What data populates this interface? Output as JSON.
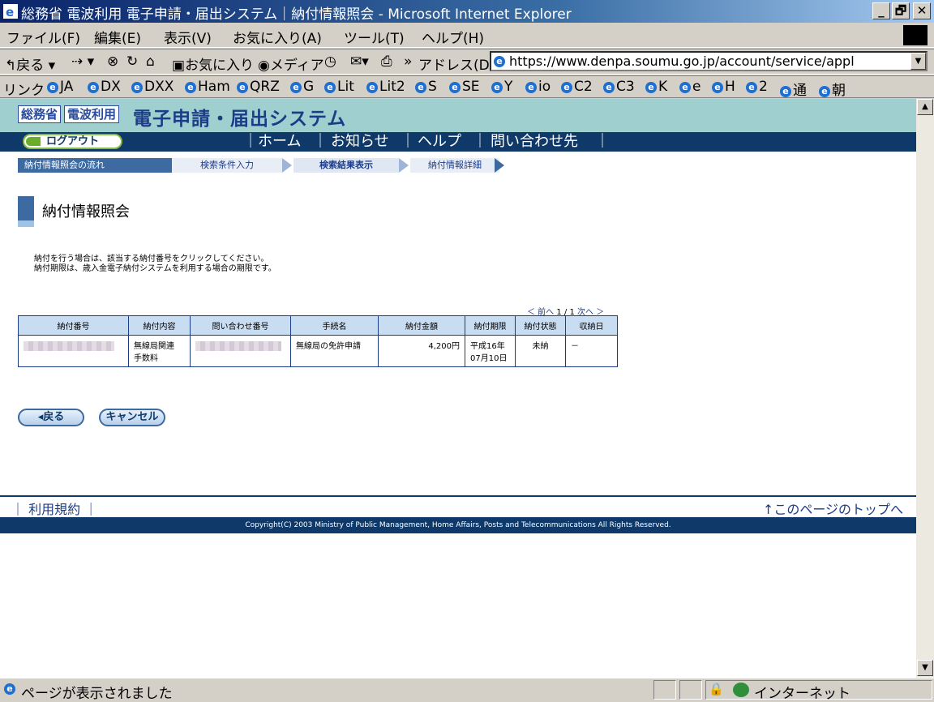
{
  "window": {
    "title": "総務省 電波利用 電子申請・届出システム｜納付情報照会 - Microsoft Internet Explorer",
    "min": "_",
    "max": "🗗",
    "close": "✕"
  },
  "menu": [
    "ファイル(F)",
    "編集(E)",
    "表示(V)",
    "お気に入り(A)",
    "ツール(T)",
    "ヘルプ(H)"
  ],
  "toolbar": {
    "back": "戻る",
    "favorites": "お気に入り",
    "media": "メディア",
    "address_label": "アドレス(D)",
    "address_value": "https://www.denpa.soumu.go.jp/account/service/appl"
  },
  "links": {
    "label": "リンク",
    "items": [
      "JA",
      "DX",
      "DXX",
      "Ham",
      "QRZ",
      "G",
      "Lit",
      "Lit2",
      "S",
      "SE",
      "Y",
      "io",
      "C2",
      "C3",
      "K",
      "e",
      "H",
      "2",
      "通",
      "朝"
    ]
  },
  "site": {
    "logo_ministry": "総務省",
    "logo_service": "電波利用",
    "system_name": "電子申請・届出システム",
    "logout": "ログアウト",
    "nav": [
      "ホーム",
      "お知らせ",
      "ヘルプ",
      "問い合わせ先"
    ]
  },
  "flow": {
    "label": "納付情報照会の流れ",
    "steps": [
      "検索条件入力",
      "検索結果表示",
      "納付情報詳細"
    ]
  },
  "page": {
    "title": "納付情報照会",
    "note1": "納付を行う場合は、該当する納付番号をクリックしてください。",
    "note2": "納付期限は、歳入金電子納付システムを利用する場合の期限です。"
  },
  "pager": {
    "prev": "＜ 前へ",
    "count": "1 / 1",
    "next": "次へ ＞"
  },
  "table": {
    "headers": [
      "納付番号",
      "納付内容",
      "問い合わせ番号",
      "手続名",
      "納付金額",
      "納付期限",
      "納付状態",
      "収納日"
    ],
    "row": {
      "content_line1": "無線局関連",
      "content_line2": "手数料",
      "procedure": "無線局の免許申請",
      "amount": "4,200円",
      "due_line1": "平成16年",
      "due_line2": "07月10日",
      "status": "未納",
      "received": "－"
    }
  },
  "buttons": {
    "back": "◂戻る",
    "cancel": "キャンセル"
  },
  "footer": {
    "terms": "｜ 利用規約 ｜",
    "to_top": "↑このページのトップへ",
    "copyright": "Copyright(C) 2003 Ministry of Public Management, Home Affairs, Posts and Telecommunications All Rights Reserved."
  },
  "statusbar": {
    "message": "ページが表示されました",
    "zone": "インターネット"
  }
}
